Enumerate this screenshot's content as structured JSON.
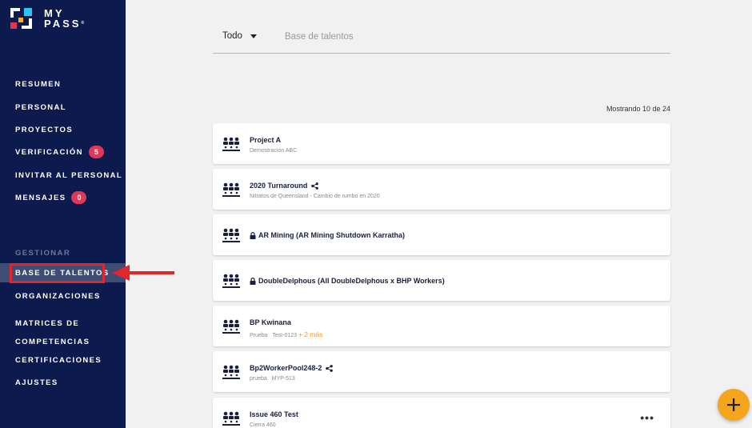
{
  "brand": {
    "line1": "MY",
    "line2": "PASS",
    "mark": "®"
  },
  "nav": {
    "items": [
      {
        "label": "RESUMEN"
      },
      {
        "label": "PERSONAL"
      },
      {
        "label": "PROYECTOS"
      },
      {
        "label": "VERIFICACIÓN",
        "badge": "5"
      },
      {
        "label": "INVITAR AL PERSONAL"
      },
      {
        "label": "MENSAJES",
        "badge": "0"
      }
    ],
    "section": "GESTIONAR",
    "manage": [
      {
        "label": "BASE DE TALENTOS",
        "active": true
      },
      {
        "label": "ORGANIZACIONES"
      },
      {
        "label_line1": "MATRICES DE",
        "label_line2": "COMPETENCIAS"
      },
      {
        "label": "CERTIFICACIONES"
      },
      {
        "label": "AJUSTES"
      }
    ]
  },
  "filter": {
    "selected": "Todo",
    "search_placeholder": "Base de talentos"
  },
  "list": {
    "count": "Mostrando 10 de 24",
    "cards": [
      {
        "title": "Project A",
        "subtitle": "Demostración ABC"
      },
      {
        "title": "2020 Turnaround",
        "subtitle": "Nitratos de Queensland - Cambio de rumbo en 2020",
        "shared": true
      },
      {
        "title": "AR Mining (AR Mining Shutdown Karratha)",
        "locked": true
      },
      {
        "title": "DoubleDelphous (All DoubleDelphous x BHP Workers)",
        "locked": true
      },
      {
        "title": "BP Kwinana",
        "subtitle": "Prueba   Test-0123",
        "more": "+ 2 más"
      },
      {
        "title": "Bp2WorkerPool248-2",
        "subtitle": "prueba   MYP-513",
        "shared": true
      },
      {
        "title": "Issue 460 Test",
        "subtitle": "Cierra 460",
        "menu": "•••"
      }
    ]
  },
  "colors": {
    "sidebar": "#0d1a4d",
    "badge": "#e03657",
    "fab": "#f5a51c",
    "annotation": "#e3262b"
  }
}
